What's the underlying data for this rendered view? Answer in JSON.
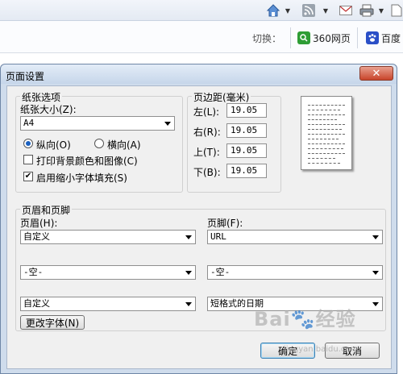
{
  "browser": {
    "switch_label": "切换：",
    "engines": [
      {
        "name": "360网页",
        "icon": "search-icon",
        "color": "#2e9d35"
      },
      {
        "name": "百度",
        "icon": "baidu-paw-icon",
        "color": "#2a4fc7"
      }
    ]
  },
  "dialog": {
    "title": "页面设置",
    "paper": {
      "group_title": "纸张选项",
      "size_label": "纸张大小(Z):",
      "size_value": "A4",
      "portrait_label": "纵向(O)",
      "landscape_label": "横向(A)",
      "orientation_selected": "portrait",
      "print_bg_label": "打印背景颜色和图像(C)",
      "print_bg_checked": false,
      "shrink_label": "启用缩小字体填充(S)",
      "shrink_checked": true
    },
    "margins": {
      "group_title": "页边距(毫米)",
      "left_label": "左(L):",
      "left_value": "19.05",
      "right_label": "右(R):",
      "right_value": "19.05",
      "top_label": "上(T):",
      "top_value": "19.05",
      "bottom_label": "下(B):",
      "bottom_value": "19.05"
    },
    "header_footer": {
      "group_title": "页眉和页脚",
      "header_label": "页眉(H):",
      "footer_label": "页脚(F):",
      "header_values": [
        "自定义",
        "-空-",
        "自定义"
      ],
      "footer_values": [
        "URL",
        "-空-",
        "短格式的日期"
      ],
      "font_button": "更改字体(N)"
    },
    "ok_button": "确定",
    "cancel_button": "取消"
  },
  "watermark": {
    "text": "Bai🐾经验",
    "url": "jingyan.baidu.com"
  }
}
